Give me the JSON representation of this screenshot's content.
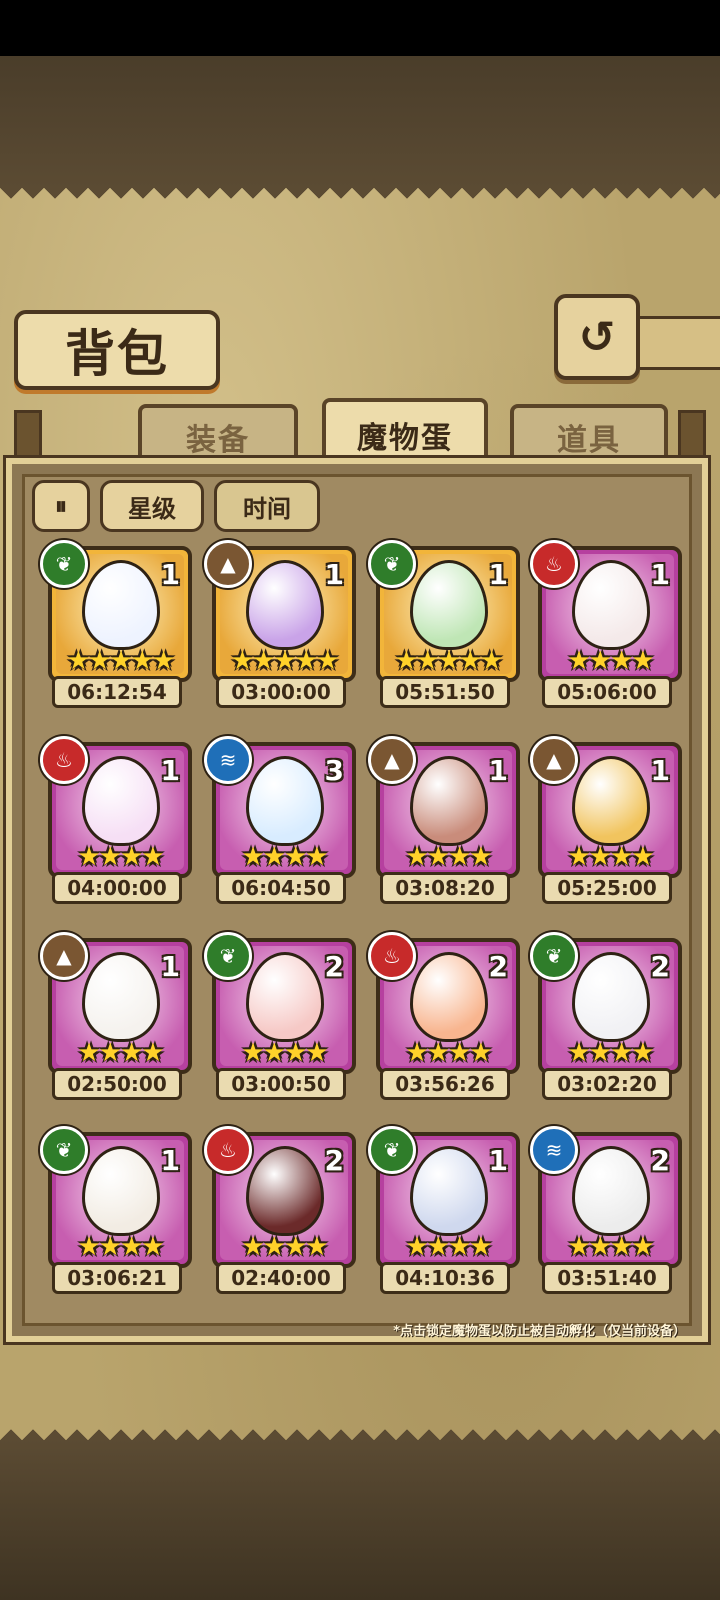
{
  "header": {
    "title": "背包",
    "back_icon": "↺"
  },
  "tabs": [
    {
      "label": "装备",
      "active": false
    },
    {
      "label": "魔物蛋",
      "active": true
    },
    {
      "label": "道具",
      "active": false
    }
  ],
  "controls": {
    "sort_icon": "⏸",
    "sort_star": "星级",
    "sort_time": "时间"
  },
  "eggs": [
    {
      "element": "leaf",
      "count": "1",
      "stars": "★★★★★",
      "time": "06:12:54",
      "rarity": "gold"
    },
    {
      "element": "rock",
      "count": "1",
      "stars": "★★★★★",
      "time": "03:00:00",
      "rarity": "gold"
    },
    {
      "element": "leaf",
      "count": "1",
      "stars": "★★★★★",
      "time": "05:51:50",
      "rarity": "gold"
    },
    {
      "element": "fire",
      "count": "1",
      "stars": "★★★★",
      "time": "05:06:00",
      "rarity": "purple"
    },
    {
      "element": "fire",
      "count": "1",
      "stars": "★★★★",
      "time": "04:00:00",
      "rarity": "purple"
    },
    {
      "element": "water",
      "count": "3",
      "stars": "★★★★",
      "time": "06:04:50",
      "rarity": "purple"
    },
    {
      "element": "rock",
      "count": "1",
      "stars": "★★★★",
      "time": "03:08:20",
      "rarity": "purple"
    },
    {
      "element": "rock",
      "count": "1",
      "stars": "★★★★",
      "time": "05:25:00",
      "rarity": "purple"
    },
    {
      "element": "rock",
      "count": "1",
      "stars": "★★★★",
      "time": "02:50:00",
      "rarity": "purple"
    },
    {
      "element": "leaf",
      "count": "2",
      "stars": "★★★★",
      "time": "03:00:50",
      "rarity": "purple"
    },
    {
      "element": "fire",
      "count": "2",
      "stars": "★★★★",
      "time": "03:56:26",
      "rarity": "purple"
    },
    {
      "element": "leaf",
      "count": "2",
      "stars": "★★★★",
      "time": "03:02:20",
      "rarity": "purple"
    },
    {
      "element": "leaf",
      "count": "1",
      "stars": "★★★★",
      "time": "03:06:21",
      "rarity": "purple"
    },
    {
      "element": "fire",
      "count": "2",
      "stars": "★★★★",
      "time": "02:40:00",
      "rarity": "purple"
    },
    {
      "element": "leaf",
      "count": "1",
      "stars": "★★★★",
      "time": "04:10:36",
      "rarity": "purple"
    },
    {
      "element": "water",
      "count": "2",
      "stars": "★★★★",
      "time": "03:51:40",
      "rarity": "purple"
    }
  ],
  "footer_note": "*点击锁定魔物蛋以防止被自动孵化（仅当前设备）",
  "colors": {
    "egg_fill": [
      "#eef3ff",
      "#c9a3e8",
      "#bfe6b5",
      "#f4e9e9",
      "#f6dff5",
      "#d8ecff",
      "#c98c7b",
      "#f1c45e",
      "#f5f2ee",
      "#f6c9c6",
      "#f8b58f",
      "#f1f1f4",
      "#f2ece3",
      "#6b2a2a",
      "#cfd8ee",
      "#ececec"
    ]
  },
  "element_icons": {
    "leaf": "❦",
    "fire": "♨",
    "rock": "▲",
    "water": "≋"
  }
}
